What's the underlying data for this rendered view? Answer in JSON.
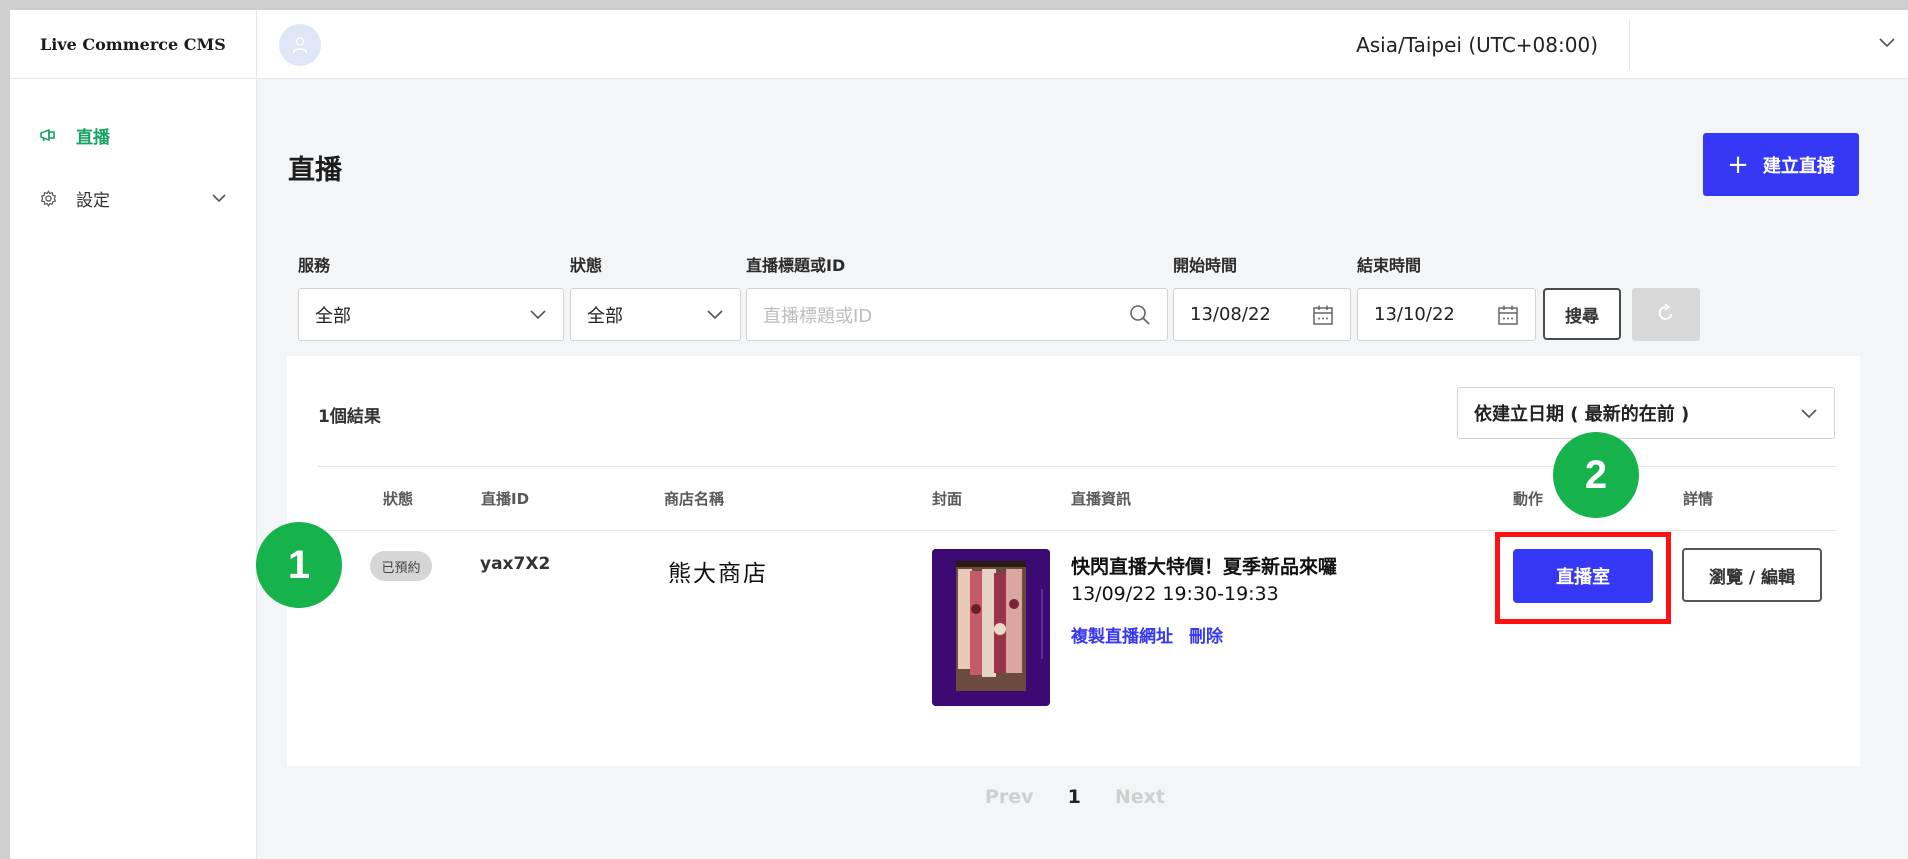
{
  "app": {
    "brand": "Live Commerce CMS"
  },
  "sidebar": {
    "items": [
      {
        "label": "直播",
        "icon": "megaphone-icon",
        "active": true
      },
      {
        "label": "設定",
        "icon": "gear-icon",
        "active": false
      }
    ]
  },
  "header": {
    "timezone": "Asia/Taipei (UTC+08:00)"
  },
  "page": {
    "title": "直播",
    "create_label": "建立直播"
  },
  "filters": {
    "service": {
      "label": "服務",
      "value": "全部"
    },
    "status": {
      "label": "狀態",
      "value": "全部"
    },
    "keyword": {
      "label": "直播標題或ID",
      "placeholder": "直播標題或ID"
    },
    "start": {
      "label": "開始時間",
      "value": "13/08/22"
    },
    "end": {
      "label": "結束時間",
      "value": "13/10/22"
    },
    "search_label": "搜尋"
  },
  "results": {
    "count_label": "1個結果",
    "sort_value": "依建立日期 ( 最新的在前 )",
    "columns": [
      "狀態",
      "直播ID",
      "商店名稱",
      "封面",
      "直播資訊",
      "動作",
      "詳情"
    ],
    "rows": [
      {
        "status": "已預約",
        "id": "yax7X2",
        "shop": "熊大商店",
        "title": "快閃直播大特價！夏季新品來囉",
        "time": "13/09/22 19:30-19:33",
        "link_copy": "複製直播網址",
        "link_delete": "刪除",
        "action_label": "直播室",
        "detail_label": "瀏覽 / 編輯"
      }
    ]
  },
  "annotations": {
    "marker_1": "1",
    "marker_2": "2"
  },
  "pagination": {
    "prev": "Prev",
    "current": "1",
    "next": "Next"
  },
  "colors": {
    "primary": "#3538f5",
    "active_nav": "#1aa368",
    "marker": "#16b24c",
    "highlight": "#ff1111"
  }
}
